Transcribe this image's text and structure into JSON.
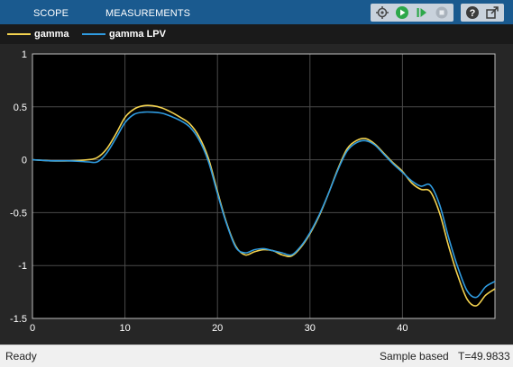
{
  "tabs": [
    {
      "label": "SCOPE"
    },
    {
      "label": "MEASUREMENTS"
    }
  ],
  "toolbar": {
    "icons": [
      "config-icon",
      "run-icon",
      "step-forward-icon",
      "stop-icon",
      "help-icon",
      "undock-icon"
    ]
  },
  "legend": [
    {
      "label": "gamma",
      "color": "#f3d24f"
    },
    {
      "label": "gamma LPV",
      "color": "#2f9be0"
    }
  ],
  "status": {
    "state": "Ready",
    "mode": "Sample based",
    "time": "T=49.9833"
  },
  "chart_data": {
    "type": "line",
    "xlim": [
      0,
      50
    ],
    "ylim": [
      -1.5,
      1
    ],
    "xticks": [
      "0",
      "10",
      "20",
      "30",
      "40"
    ],
    "yticks": [
      "1",
      "0.5",
      "0",
      "-0.5",
      "-1",
      "-1.5"
    ],
    "grid": true,
    "series": [
      {
        "name": "gamma",
        "color": "#f3d24f",
        "x": [
          0,
          2,
          4,
          6,
          7,
          8,
          9,
          10,
          11,
          12,
          13,
          14,
          15,
          16,
          17,
          18,
          19,
          20,
          21,
          22,
          23,
          24,
          25,
          26,
          27,
          28,
          29,
          30,
          31,
          32,
          33,
          34,
          35,
          36,
          37,
          38,
          39,
          40,
          41,
          42,
          43,
          44,
          45,
          46,
          47,
          48,
          49,
          50
        ],
        "values": [
          0,
          -0.01,
          -0.01,
          0,
          0.02,
          0.1,
          0.24,
          0.4,
          0.48,
          0.51,
          0.51,
          0.49,
          0.45,
          0.4,
          0.34,
          0.22,
          0.02,
          -0.3,
          -0.6,
          -0.82,
          -0.9,
          -0.87,
          -0.85,
          -0.86,
          -0.9,
          -0.91,
          -0.83,
          -0.7,
          -0.53,
          -0.32,
          -0.09,
          0.1,
          0.18,
          0.2,
          0.15,
          0.06,
          -0.03,
          -0.11,
          -0.22,
          -0.28,
          -0.3,
          -0.5,
          -0.82,
          -1.1,
          -1.32,
          -1.38,
          -1.28,
          -1.22
        ]
      },
      {
        "name": "gamma LPV",
        "color": "#2f9be0",
        "x": [
          0,
          2,
          4,
          6,
          7,
          8,
          9,
          10,
          11,
          12,
          13,
          14,
          15,
          16,
          17,
          18,
          19,
          20,
          21,
          22,
          23,
          24,
          25,
          26,
          27,
          28,
          29,
          30,
          31,
          32,
          33,
          34,
          35,
          36,
          37,
          38,
          39,
          40,
          41,
          42,
          43,
          44,
          45,
          46,
          47,
          48,
          49,
          50
        ],
        "values": [
          0,
          -0.01,
          -0.01,
          -0.02,
          -0.02,
          0.06,
          0.2,
          0.35,
          0.43,
          0.45,
          0.45,
          0.44,
          0.41,
          0.37,
          0.31,
          0.19,
          -0.01,
          -0.32,
          -0.61,
          -0.83,
          -0.88,
          -0.85,
          -0.84,
          -0.86,
          -0.88,
          -0.9,
          -0.82,
          -0.69,
          -0.52,
          -0.32,
          -0.1,
          0.08,
          0.16,
          0.18,
          0.14,
          0.05,
          -0.04,
          -0.12,
          -0.2,
          -0.25,
          -0.24,
          -0.42,
          -0.74,
          -1.02,
          -1.24,
          -1.3,
          -1.2,
          -1.15
        ]
      }
    ]
  }
}
